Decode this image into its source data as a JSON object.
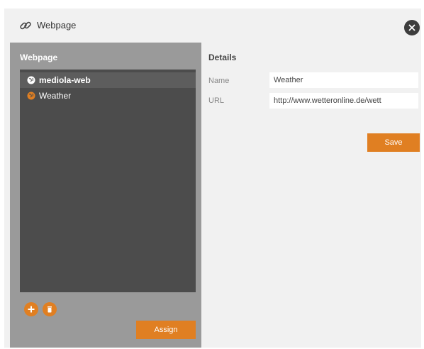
{
  "dialog": {
    "title": "Webpage",
    "title_icon": "link-icon",
    "close_icon": "close-icon"
  },
  "left_panel": {
    "header": "Webpage",
    "items": [
      {
        "label": "mediola-web",
        "icon": "globe-icon",
        "icon_color": "#ffffff",
        "selected": true
      },
      {
        "label": "Weather",
        "icon": "globe-icon",
        "icon_color": "#e07f22",
        "selected": false
      }
    ],
    "add_icon": "add-icon",
    "delete_icon": "trash-icon",
    "assign_label": "Assign"
  },
  "details": {
    "header": "Details",
    "name_label": "Name",
    "name_value": "Weather",
    "url_label": "URL",
    "url_value": "http://www.wetteronline.de/wett",
    "save_label": "Save"
  },
  "colors": {
    "accent": "#e07f22",
    "panel_bg": "#9a9a9a",
    "list_bg": "#4c4c4c",
    "dialog_bg": "#f1f1f1"
  }
}
